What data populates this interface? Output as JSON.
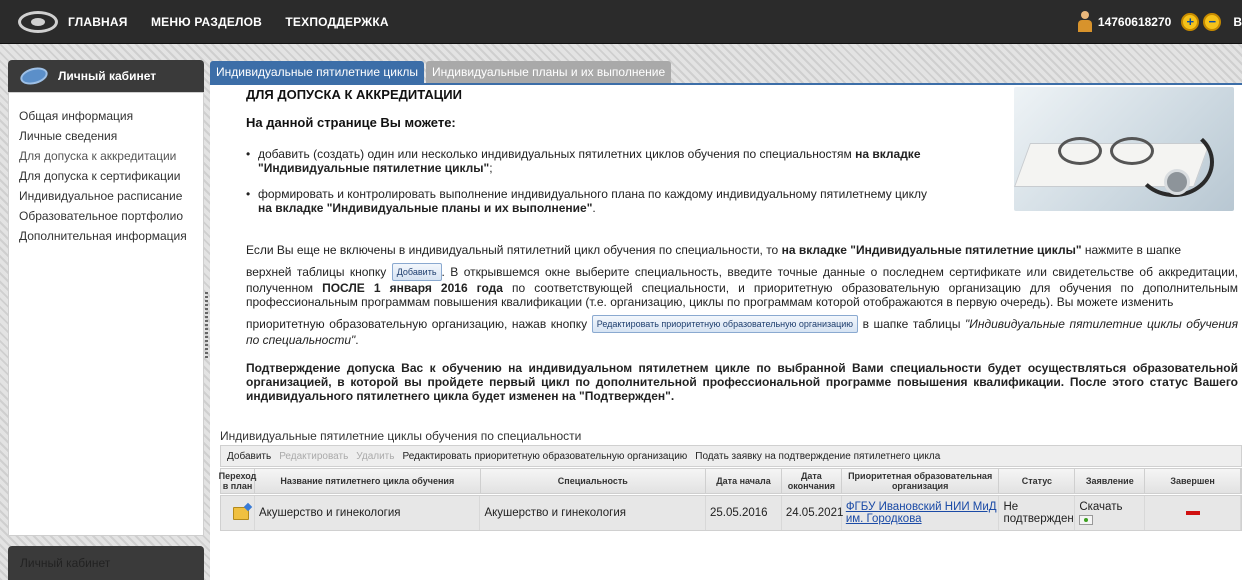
{
  "header": {
    "nav": [
      "ГЛАВНАЯ",
      "МЕНЮ РАЗДЕЛОВ",
      "ТЕХПОДДЕРЖКА"
    ],
    "user_id": "14760618270",
    "zoom_in": "+",
    "zoom_out": "−",
    "cut_letter": "В"
  },
  "sidebar": {
    "title": "Личный кабинет",
    "items": [
      "Общая информация",
      "Личные сведения",
      "Для допуска к аккредитации",
      "Для допуска к сертификации",
      "Индивидуальное расписание",
      "Образовательное портфолио",
      "Дополнительная информация"
    ],
    "bottom_title": "Личный кабинет"
  },
  "tabs": [
    "Индивидуальные пятилетние циклы",
    "Индивидуальные планы и их выполнение"
  ],
  "content": {
    "title": "ДЛЯ ДОПУСКА К АККРЕДИТАЦИИ",
    "subtitle": "На данной странице Вы можете:",
    "bullet1_a": "добавить (создать) один или несколько индивидуальных пятилетних циклов обучения по специальностям ",
    "bullet1_b": "на вкладке \"Индивидуальные пятилетние циклы\"",
    "bullet1_c": ";",
    "bullet2_a": "формировать и контролировать выполнение индивидуального плана по каждому индивидуальному пятилетнему циклу ",
    "bullet2_b": "на вкладке \"Индивидуальные планы и их выполнение\"",
    "bullet2_c": ".",
    "p1_a": "Если Вы еще не включены в индивидуальный пятилетний цикл обучения по специальности, то ",
    "p1_b": "на вкладке \"Индивидуальные пятилетние циклы\"",
    "p1_c": " нажмите в шапке",
    "p2_a": "верхней таблицы кнопку ",
    "add_btn": "Добавить",
    "p2_b": ". В открывшемся окне выберите специальность, введите точные данные о последнем сертификате или свидетельстве об аккредитации, полученном ",
    "p2_c": "ПОСЛЕ 1 января 2016 года",
    "p2_d": " по соответствующей специальности, и приоритетную образовательную организацию для обучения по дополнительным профессиональным программам повышения квалификации (т.е. организацию, циклы по программам которой отображаются в первую очередь). Вы можете изменить",
    "p3_a": "приоритетную образовательную организацию, нажав кнопку ",
    "edit_btn": "Редактировать приоритетную образовательную организацию",
    "p3_b": " в шапке таблицы ",
    "p3_c": "\"Индивидуальные пятилетние циклы обучения по специальности\"",
    "p3_d": ".",
    "p4": "Подтверждение допуска Вас к обучению на индивидуальном пятилетнем цикле по выбранной Вами специальности будет осуществляться образовательной организацией, в которой вы пройдете первый цикл по дополнительной профессиональной программе повышения квалификации. После этого статус Вашего индивидуального пятилетнего цикла будет изменен на \"Подтвержден\"."
  },
  "table": {
    "caption": "Индивидуальные пятилетние циклы обучения по специальности",
    "toolbar": [
      "Добавить",
      "Редактировать",
      "Удалить",
      "Редактировать приоритетную образовательную организацию",
      "Подать заявку на подтверждение пятилетнего цикла"
    ],
    "columns": [
      "Переход в план",
      "Название пятилетнего цикла обучения",
      "Специальность",
      "Дата начала",
      "Дата окончания",
      "Приоритетная образовательная организация",
      "Статус",
      "Заявление",
      "Завершен"
    ],
    "rows": [
      {
        "name": "Акушерство и гинекология",
        "specialty": "Акушерство и гинекология",
        "start": "25.05.2016",
        "end": "24.05.2021",
        "org": "ФГБУ Ивановский НИИ МиД им. Городкова",
        "status": "Не подтвержден",
        "application": "Скачать"
      }
    ]
  }
}
